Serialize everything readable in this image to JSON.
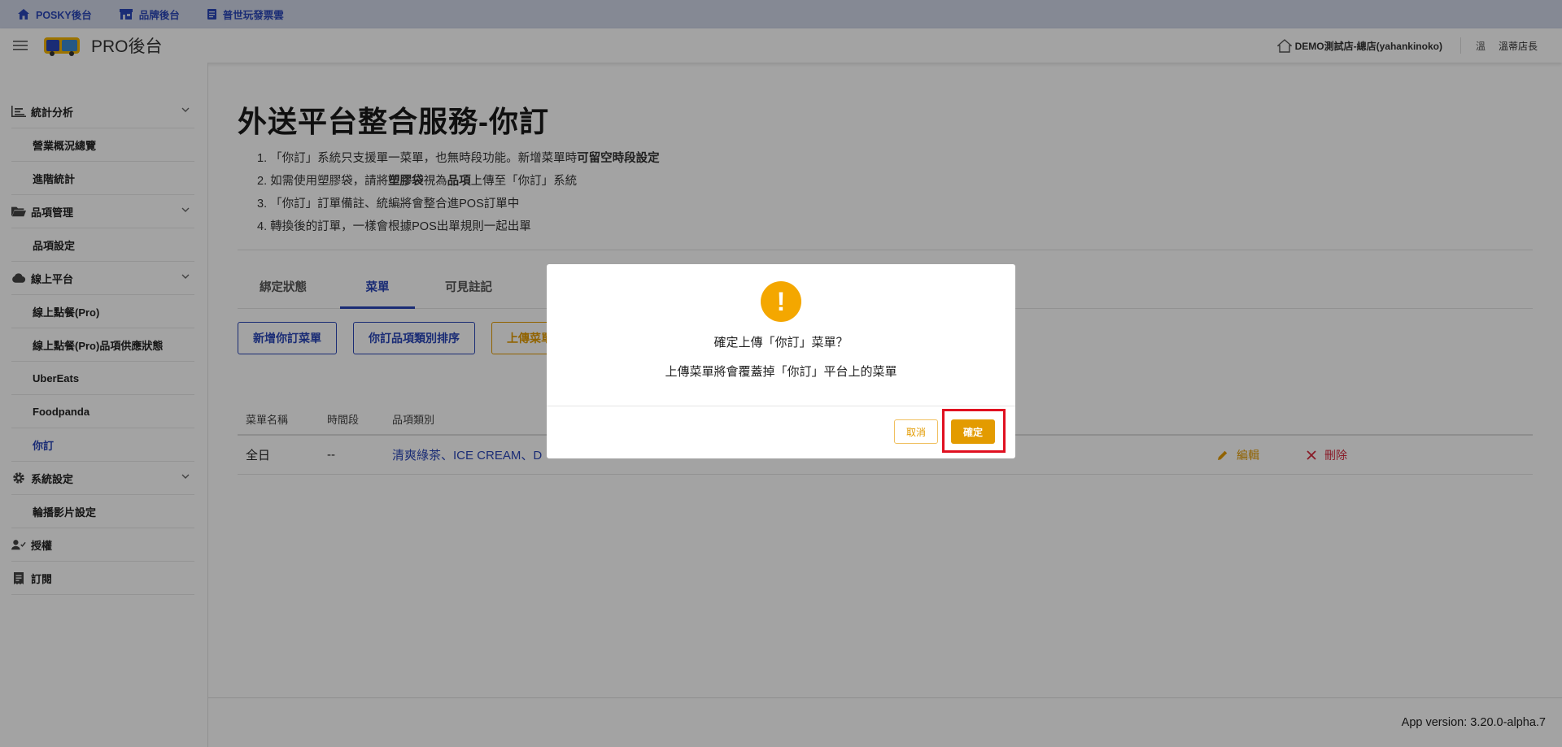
{
  "topbar": {
    "links": [
      {
        "label": "POSKY後台",
        "icon": "home-icon"
      },
      {
        "label": "品牌後台",
        "icon": "store-icon"
      },
      {
        "label": "普世玩發票雲",
        "icon": "document-icon"
      }
    ]
  },
  "header": {
    "title": "PRO後台",
    "store": "DEMO測試店-總店(yahankinoko)",
    "user_avatar": "溫",
    "user_name": "溫蒂店長"
  },
  "sidebar": {
    "sections": [
      {
        "label": "統計分析",
        "icon": "chart-icon",
        "items": [
          "營業概況總覽",
          "進階統計"
        ]
      },
      {
        "label": "品項管理",
        "icon": "folder-icon",
        "items": [
          "品項設定"
        ]
      },
      {
        "label": "線上平台",
        "icon": "cloud-icon",
        "items": [
          "線上點餐(Pro)",
          "線上點餐(Pro)品項供應狀態",
          "UberEats",
          "Foodpanda",
          "你訂"
        ]
      },
      {
        "label": "系統設定",
        "icon": "gear-icon",
        "items": [
          "輪播影片設定"
        ]
      },
      {
        "label": "授權",
        "icon": "user-check-icon",
        "items": []
      },
      {
        "label": "訂閱",
        "icon": "receipt-icon",
        "items": []
      }
    ],
    "active_item": "你訂"
  },
  "main": {
    "title": "外送平台整合服務-你訂",
    "notes": {
      "n1_pre": "1. 「你訂」系統只支援單一菜單，也無時段功能。新增菜單時",
      "n1_bold": "可留空時段設定",
      "n2_pre": "2. 如需使用塑膠袋，請將",
      "n2_bold1": "塑膠袋",
      "n2_mid": "視為",
      "n2_bold2": "品項",
      "n2_post": "上傳至「你訂」系統",
      "n3": "3. 「你訂」訂單備註、統編將會整合進POS訂單中",
      "n4": "4. 轉換後的訂單，一樣會根據POS出單規則一起出單"
    },
    "tabs": [
      {
        "label": "綁定狀態",
        "active": false
      },
      {
        "label": "菜單",
        "active": true
      },
      {
        "label": "可見註記",
        "active": false
      }
    ],
    "buttons": {
      "add_menu": "新增你訂菜單",
      "sort_categories": "你訂品項類別排序",
      "upload_menu": "上傳菜單"
    },
    "table": {
      "headers": [
        "菜單名稱",
        "時間段",
        "品項類別"
      ],
      "rows": [
        {
          "name": "全日",
          "time": "--",
          "categories": "清爽綠茶、ICE CREAM、D",
          "edit": "編輯",
          "delete": "刪除"
        }
      ]
    }
  },
  "footer": {
    "version": "App version: 3.20.0-alpha.7"
  },
  "modal": {
    "icon": "warning-icon",
    "title": "確定上傳「你訂」菜單？",
    "body": "上傳菜單將會覆蓋掉「你訂」平台上的菜單",
    "cancel": "取消",
    "confirm": "確定"
  },
  "colors": {
    "primary": "#2a46b8",
    "warning": "#e39b00",
    "danger": "#d62b3f",
    "highlight": "#e01020"
  }
}
